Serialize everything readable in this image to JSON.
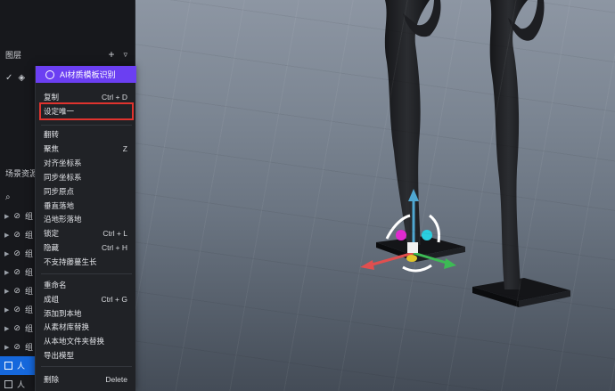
{
  "layers_panel": {
    "title": "图层",
    "add_icon": "plus-icon",
    "collapse_icon": "chevron-down-icon"
  },
  "scene_panel": {
    "title": "场景资源"
  },
  "tree": {
    "rows": [
      {
        "label": "组"
      },
      {
        "label": "组"
      },
      {
        "label": "组"
      },
      {
        "label": "组"
      },
      {
        "label": "组"
      },
      {
        "label": "组"
      },
      {
        "label": "组"
      },
      {
        "label": "组"
      },
      {
        "label": "人",
        "selected": true
      },
      {
        "label": "人"
      }
    ]
  },
  "context_menu": {
    "banner": "AI材质模板识别",
    "groups": [
      [
        {
          "label": "复制",
          "shortcut": "Ctrl + D"
        },
        {
          "label": "设定唯一",
          "shortcut": "",
          "highlight": true
        }
      ],
      [
        {
          "label": "翻转",
          "shortcut": ""
        },
        {
          "label": "聚焦",
          "shortcut": "Z"
        },
        {
          "label": "对齐坐标系",
          "shortcut": ""
        },
        {
          "label": "同步坐标系",
          "shortcut": ""
        },
        {
          "label": "同步原点",
          "shortcut": ""
        },
        {
          "label": "垂直落地",
          "shortcut": ""
        },
        {
          "label": "沿地形落地",
          "shortcut": ""
        },
        {
          "label": "锁定",
          "shortcut": "Ctrl + L"
        },
        {
          "label": "隐藏",
          "shortcut": "Ctrl + H"
        },
        {
          "label": "不支持藤蔓生长",
          "shortcut": ""
        }
      ],
      [
        {
          "label": "重命名",
          "shortcut": ""
        },
        {
          "label": "成组",
          "shortcut": "Ctrl + G"
        },
        {
          "label": "添加到本地",
          "shortcut": ""
        },
        {
          "label": "从素材库替换",
          "shortcut": ""
        },
        {
          "label": "从本地文件夹替换",
          "shortcut": ""
        },
        {
          "label": "导出模型",
          "shortcut": ""
        }
      ],
      [
        {
          "label": "删除",
          "shortcut": "Delete"
        }
      ]
    ]
  },
  "colors": {
    "accent_purple": "#6b3ff2",
    "selection_blue": "#1668dc",
    "highlight_red": "#e0332e"
  }
}
